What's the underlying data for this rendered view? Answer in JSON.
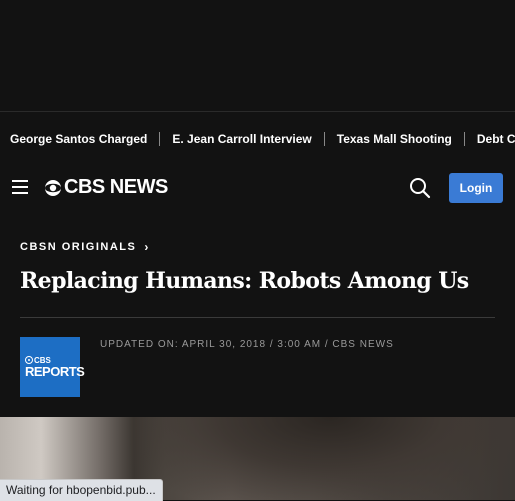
{
  "trending": {
    "items": [
      {
        "label": "George Santos Charged"
      },
      {
        "label": "E. Jean Carroll Interview"
      },
      {
        "label": "Texas Mall Shooting"
      },
      {
        "label": "Debt Cei"
      }
    ]
  },
  "nav": {
    "menu_icon": "hamburger-menu-icon",
    "logo_text": "CBS NEWS",
    "search_icon": "search-icon",
    "login_label": "Login",
    "login_color": "#3a7bd5"
  },
  "article": {
    "section": "CBSN ORIGINALS",
    "section_chevron": "›",
    "headline": "Replacing Humans: Robots Among Us",
    "source_logo": {
      "top": "CBS",
      "bottom": "REPORTS",
      "color": "#1d6ec4"
    },
    "updated": "UPDATED ON: APRIL 30, 2018 / 3:00 AM / CBS NEWS"
  },
  "status_bar": {
    "text": "Waiting for hbopenbid.pub..."
  }
}
